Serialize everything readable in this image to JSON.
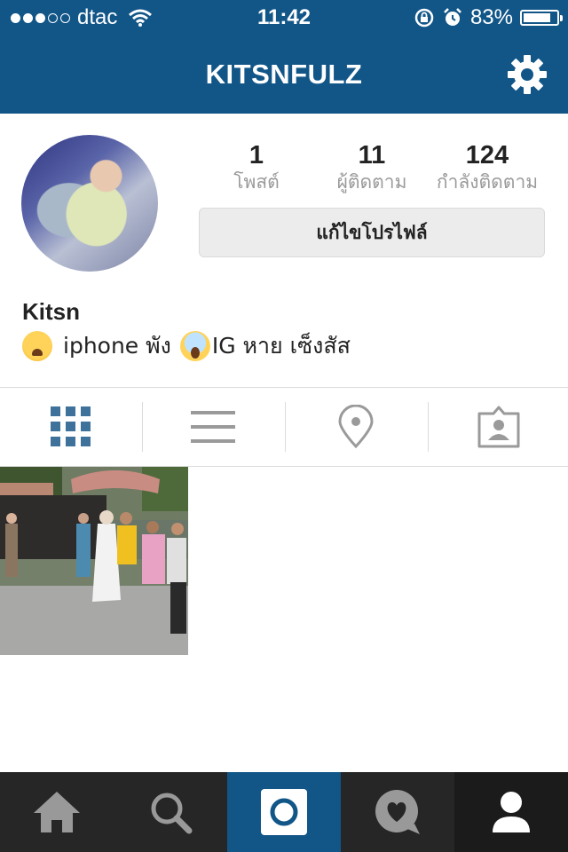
{
  "status_bar": {
    "carrier": "dtac",
    "time": "11:42",
    "battery_percent": "83%",
    "battery_level": 0.83,
    "signal_bars_filled": 3,
    "signal_bars_total": 5
  },
  "nav": {
    "title": "KITSNFULZ",
    "settings_icon": "gear-icon",
    "background_color": "#125688"
  },
  "profile": {
    "avatar_icon": "avatar",
    "stats": [
      {
        "value": "1",
        "label": "โพสต์"
      },
      {
        "value": "11",
        "label": "ผู้ติดตาม"
      },
      {
        "value": "124",
        "label": "กำลังติดตาม"
      }
    ],
    "edit_button": "แก้ไขโปรไฟล์",
    "name": "Kitsn",
    "bio_part1": "iphone พัง",
    "bio_part2": "IG หาย เซ็งสัส"
  },
  "view_tabs": [
    {
      "name": "grid-view-icon",
      "active": true
    },
    {
      "name": "list-view-icon",
      "active": false
    },
    {
      "name": "location-pin-icon",
      "active": false
    },
    {
      "name": "tagged-photos-icon",
      "active": false
    }
  ],
  "posts": [
    {
      "name": "post-thumbnail"
    }
  ],
  "bottom_tabs": [
    {
      "name": "home-icon",
      "active": false
    },
    {
      "name": "search-icon",
      "active": false
    },
    {
      "name": "camera-icon",
      "active": false
    },
    {
      "name": "activity-heart-icon",
      "active": false
    },
    {
      "name": "profile-icon",
      "active": true
    }
  ],
  "colors": {
    "accent": "#125688",
    "active_tab": "#3f729b",
    "tabbar": "#262626"
  }
}
